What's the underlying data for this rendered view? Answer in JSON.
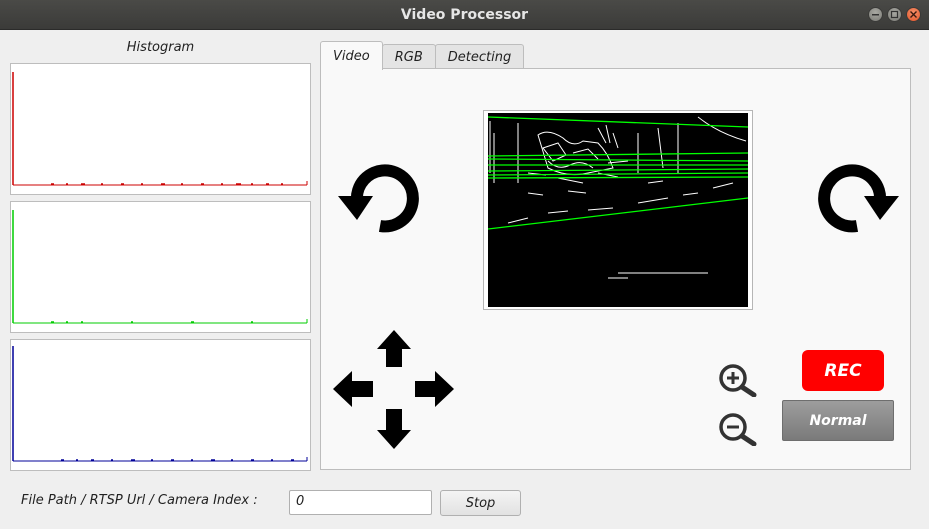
{
  "window": {
    "title": "Video Processor"
  },
  "histogram": {
    "title": "Histogram",
    "channels": [
      {
        "name": "red",
        "color": "#cc0000"
      },
      {
        "name": "green",
        "color": "#00cc00"
      },
      {
        "name": "blue",
        "color": "#000099"
      }
    ]
  },
  "tabs": [
    {
      "label": "Video",
      "active": true
    },
    {
      "label": "RGB",
      "active": false
    },
    {
      "label": "Detecting",
      "active": false
    }
  ],
  "controls": {
    "rotate_left_icon": "rotate-left-icon",
    "rotate_right_icon": "rotate-right-icon",
    "pan_icon": "pan-arrows-icon",
    "zoom_in_icon": "zoom-in-icon",
    "zoom_out_icon": "zoom-out-icon",
    "rec_label": "REC",
    "rec_color": "#ff0000",
    "normal_label": "Normal"
  },
  "source": {
    "label": "File Path / RTSP Url / Camera Index :",
    "value": "0",
    "stop_label": "Stop"
  }
}
